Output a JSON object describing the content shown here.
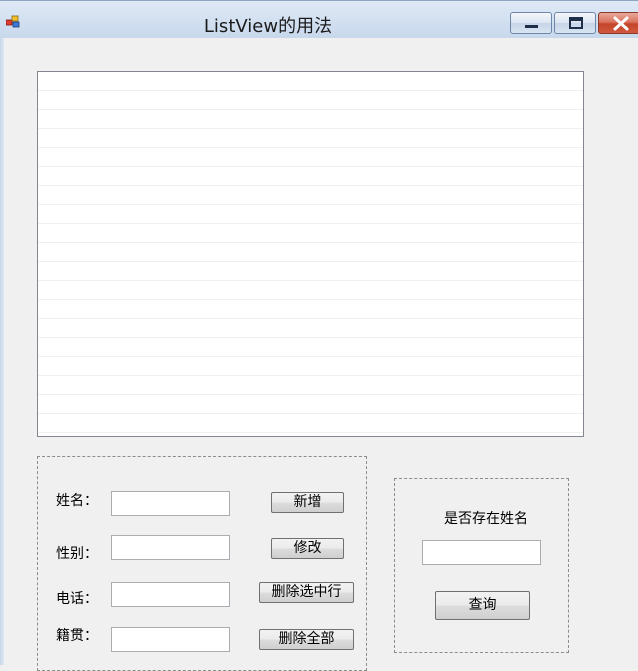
{
  "window": {
    "title": "ListView的用法",
    "icon": "winforms-app-icon",
    "controls": [
      "minimize-icon",
      "maximize-icon",
      "close-icon"
    ]
  },
  "listview": {
    "rows": 19
  },
  "form": {
    "name_label": "姓名：",
    "name_value": "",
    "gender_label": "性别：",
    "gender_value": "",
    "phone_label": "电话：",
    "phone_value": "",
    "native_label": "籍贯：",
    "native_value": "",
    "add_button": "新增",
    "modify_button": "修改",
    "delete_selected_button": "删除选中行",
    "delete_all_button": "删除全部"
  },
  "search": {
    "label": "是否存在姓名",
    "value": "",
    "query_button": "查询"
  }
}
